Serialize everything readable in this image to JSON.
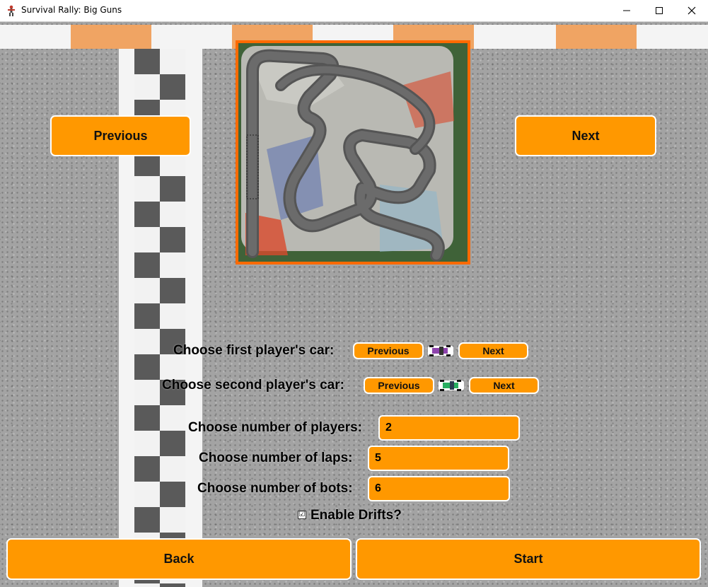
{
  "window": {
    "title": "Survival Rally: Big Guns",
    "minimize_icon": "minimize-icon",
    "maximize_icon": "maximize-icon",
    "close_icon": "close-icon"
  },
  "colors": {
    "accent": "#ff9800",
    "preview_border": "#ff6a00",
    "curb_orange": "#f2a060"
  },
  "track": {
    "previous_label": "Previous",
    "next_label": "Next",
    "preview_image": "race-track-aerial-preview"
  },
  "player1": {
    "label": "Choose first player's car:",
    "previous_label": "Previous",
    "next_label": "Next",
    "car_icon": "purple-car-icon"
  },
  "player2": {
    "label": "Choose second player's car:",
    "previous_label": "Previous",
    "next_label": "Next",
    "car_icon": "green-car-icon"
  },
  "settings": {
    "players": {
      "label": "Choose number of players:",
      "value": "2"
    },
    "laps": {
      "label": "Choose number of laps:",
      "value": "5"
    },
    "bots": {
      "label": "Choose number of bots:",
      "value": "6"
    },
    "drifts": {
      "label": "Enable Drifts?",
      "checked": true,
      "check_glyph": "☑"
    }
  },
  "footer": {
    "back_label": "Back",
    "start_label": "Start"
  }
}
